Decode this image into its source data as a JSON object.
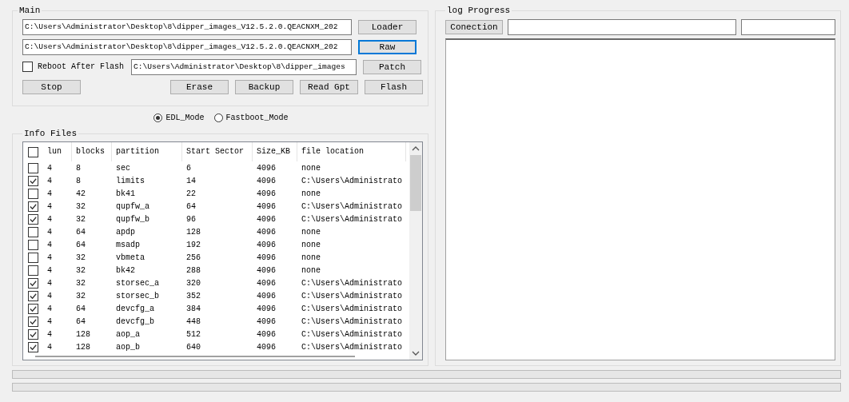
{
  "main": {
    "title": "Main",
    "paths": [
      {
        "value": "C:\\Users\\Administrator\\Desktop\\8\\dipper_images_V12.5.2.0.QEACNXM_202"
      },
      {
        "value": "C:\\Users\\Administrator\\Desktop\\8\\dipper_images_V12.5.2.0.QEACNXM_202"
      }
    ],
    "side_buttons": [
      {
        "label": "Loader",
        "focused": false
      },
      {
        "label": "Raw",
        "focused": true
      },
      {
        "label": "Patch",
        "focused": false
      }
    ],
    "reboot": {
      "label": "Reboot After Flash",
      "checked": false,
      "path": "C:\\Users\\Administrator\\Desktop\\8\\dipper_images"
    },
    "stop_button": "Stop",
    "action_buttons": [
      "Erase",
      "Backup",
      "Read Gpt",
      "Flash"
    ]
  },
  "modes": [
    {
      "label": "EDL_Mode",
      "selected": true
    },
    {
      "label": "Fastboot_Mode",
      "selected": false
    }
  ],
  "info_files": {
    "title": "Info Files",
    "all_checked": false,
    "columns": [
      "lun",
      "blocks",
      "partition",
      "Start Sector",
      "Size_KB",
      "file location"
    ],
    "rows": [
      {
        "checked": false,
        "cells": [
          "4",
          "8",
          "sec",
          "6",
          "4096",
          "none"
        ]
      },
      {
        "checked": true,
        "cells": [
          "4",
          "8",
          "limits",
          "14",
          "4096",
          "C:\\Users\\Administrato"
        ]
      },
      {
        "checked": false,
        "cells": [
          "4",
          "42",
          "bk41",
          "22",
          "4096",
          "none"
        ]
      },
      {
        "checked": true,
        "cells": [
          "4",
          "32",
          "qupfw_a",
          "64",
          "4096",
          "C:\\Users\\Administrato"
        ]
      },
      {
        "checked": true,
        "cells": [
          "4",
          "32",
          "qupfw_b",
          "96",
          "4096",
          "C:\\Users\\Administrato"
        ]
      },
      {
        "checked": false,
        "cells": [
          "4",
          "64",
          "apdp",
          "128",
          "4096",
          "none"
        ]
      },
      {
        "checked": false,
        "cells": [
          "4",
          "64",
          "msadp",
          "192",
          "4096",
          "none"
        ]
      },
      {
        "checked": false,
        "cells": [
          "4",
          "32",
          "vbmeta",
          "256",
          "4096",
          "none"
        ]
      },
      {
        "checked": false,
        "cells": [
          "4",
          "32",
          "bk42",
          "288",
          "4096",
          "none"
        ]
      },
      {
        "checked": true,
        "cells": [
          "4",
          "32",
          "storsec_a",
          "320",
          "4096",
          "C:\\Users\\Administrato"
        ]
      },
      {
        "checked": true,
        "cells": [
          "4",
          "32",
          "storsec_b",
          "352",
          "4096",
          "C:\\Users\\Administrato"
        ]
      },
      {
        "checked": true,
        "cells": [
          "4",
          "64",
          "devcfg_a",
          "384",
          "4096",
          "C:\\Users\\Administrato"
        ]
      },
      {
        "checked": true,
        "cells": [
          "4",
          "64",
          "devcfg_b",
          "448",
          "4096",
          "C:\\Users\\Administrato"
        ]
      },
      {
        "checked": true,
        "cells": [
          "4",
          "128",
          "aop_a",
          "512",
          "4096",
          "C:\\Users\\Administrato"
        ]
      },
      {
        "checked": true,
        "cells": [
          "4",
          "128",
          "aop_b",
          "640",
          "4096",
          "C:\\Users\\Administrato"
        ]
      }
    ]
  },
  "log": {
    "title": "log Progress",
    "connection_button": "Conection"
  },
  "progress_bars": [
    {
      "level": 0
    },
    {
      "level": 0
    }
  ]
}
